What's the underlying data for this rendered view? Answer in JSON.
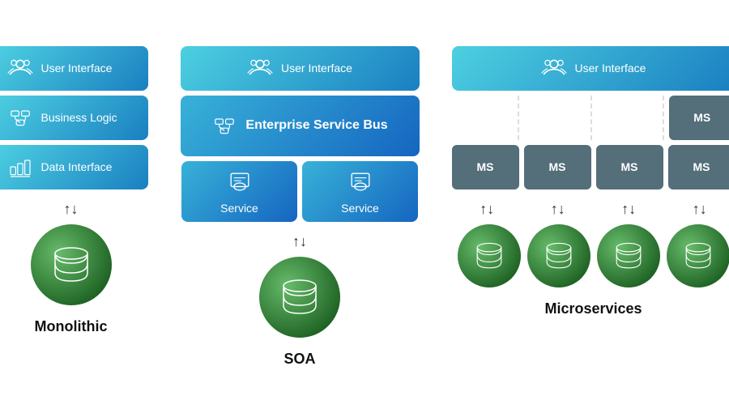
{
  "monolithic": {
    "label": "Monolithic",
    "ui_label": "User Interface",
    "logic_label": "Business Logic",
    "data_label": "Data Interface",
    "arrow": "↑↓"
  },
  "soa": {
    "label": "SOA",
    "ui_label": "User Interface",
    "esb_label": "Enterprise Service Bus",
    "service1_label": "Service",
    "service2_label": "Service",
    "arrow": "↑↓"
  },
  "microservices": {
    "label": "Microservices",
    "ui_label": "User Interface",
    "ms_labels": [
      "MS",
      "MS",
      "MS",
      "MS",
      "MS"
    ],
    "arrows": [
      "↑↓",
      "↑↓",
      "↑↓",
      "↑↓"
    ]
  }
}
